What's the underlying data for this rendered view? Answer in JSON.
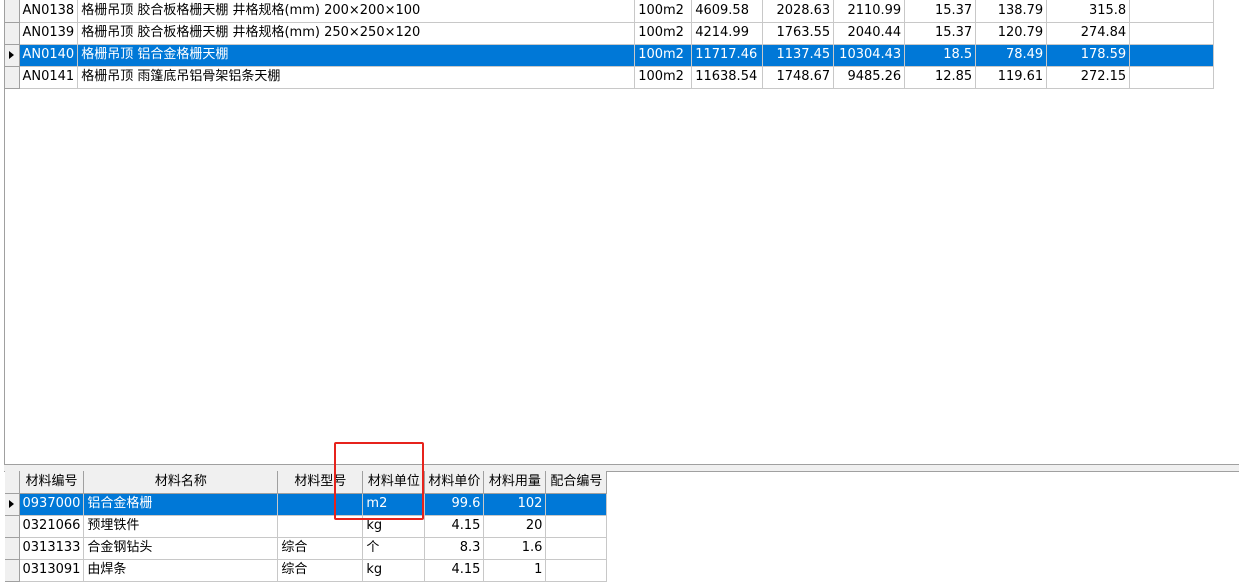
{
  "upper_grid": {
    "rows": [
      {
        "code": "AN0138",
        "name": "格栅吊顶 胶合板格栅天棚 井格规格(mm) 200×200×100",
        "unit": "100m2",
        "c1": "4609.58",
        "c2": "2028.63",
        "c3": "2110.99",
        "c4": "15.37",
        "c5": "138.79",
        "c6": "315.8",
        "selected": false
      },
      {
        "code": "AN0139",
        "name": "格栅吊顶 胶合板格栅天棚 井格规格(mm) 250×250×120",
        "unit": "100m2",
        "c1": "4214.99",
        "c2": "1763.55",
        "c3": "2040.44",
        "c4": "15.37",
        "c5": "120.79",
        "c6": "274.84",
        "selected": false
      },
      {
        "code": "AN0140",
        "name": "格栅吊顶 铝合金格栅天棚",
        "unit": "100m2",
        "c1": "11717.46",
        "c2": "1137.45",
        "c3": "10304.43",
        "c4": "18.5",
        "c5": "78.49",
        "c6": "178.59",
        "selected": true
      },
      {
        "code": "AN0141",
        "name": "格栅吊顶 雨篷底吊铝骨架铝条天棚",
        "unit": "100m2",
        "c1": "11638.54",
        "c2": "1748.67",
        "c3": "9485.26",
        "c4": "12.85",
        "c5": "119.61",
        "c6": "272.15",
        "selected": false
      }
    ]
  },
  "lower_grid": {
    "headers": {
      "code": "材料编号",
      "name": "材料名称",
      "model": "材料型号",
      "unit": "材料单位",
      "price": "材料单价",
      "qty": "材料用量",
      "mix": "配合编号"
    },
    "rows": [
      {
        "code": "0937000",
        "name": "铝合金格栅",
        "model": "",
        "unit": "m2",
        "price": "99.6",
        "qty": "102",
        "mix": "",
        "selected": true
      },
      {
        "code": "0321066",
        "name": "预埋铁件",
        "model": "",
        "unit": "kg",
        "price": "4.15",
        "qty": "20",
        "mix": "",
        "selected": false
      },
      {
        "code": "0313133",
        "name": "合金钢钻头",
        "model": "综合",
        "unit": "个",
        "price": "8.3",
        "qty": "1.6",
        "mix": "",
        "selected": false
      },
      {
        "code": "0313091",
        "name": "由焊条",
        "model": "综合",
        "unit": "kg",
        "price": "4.15",
        "qty": "1",
        "mix": "",
        "selected": false
      }
    ]
  },
  "colors": {
    "selection": "#0078d7",
    "highlight_box": "#e6231c",
    "grid_line": "#c8c8c8",
    "header_bg": "#f0f0f0"
  }
}
